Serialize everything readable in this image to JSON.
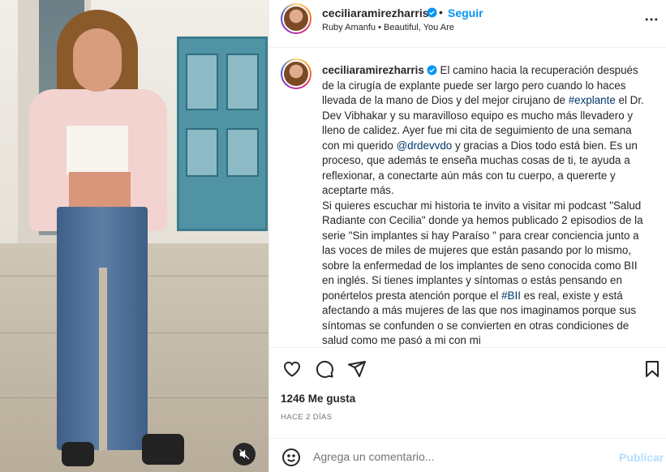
{
  "header": {
    "username": "ceciliaramirezharris",
    "separator": "•",
    "follow_label": "Seguir",
    "music": "Ruby Amanfu • Beautiful, You Are",
    "more_icon": "more-horizontal-icon"
  },
  "caption": {
    "username": "ceciliaramirezharris",
    "text_1": " El camino hacia la recuperación después de la cirugía de explante puede ser largo pero cuando lo haces llevada de la mano de Dios y del mejor cirujano de ",
    "hashtag_1": "#explante",
    "text_2": " el Dr. Dev Vibhakar y su maravilloso equipo es mucho más llevadero y lleno de calidez. Ayer fue mi cita de seguimiento de una semana con mi querido ",
    "mention_1": "@drdevvdo",
    "text_3": " y gracias a Dios todo está bien. Es un proceso, que además te enseña muchas cosas de ti, te ayuda a reflexionar, a conectarte aún más con tu cuerpo, a quererte y aceptarte más.",
    "text_4": "Si quieres escuchar mi historia te invito a visitar mi podcast \"Salud Radiante con Cecilia\" donde ya hemos publicado 2 episodios de la serie \"Sin implantes si hay Paraíso \" para crear conciencia junto a las voces de miles de mujeres que están pasando por lo mismo, sobre la enfermedad de los implantes de seno conocida como BII en inglés. Si tienes implantes y síntomas o estás pensando en ponértelos presta atención porque el ",
    "hashtag_2": "#BII",
    "text_5": " es real, existe y está afectando a más mujeres de las que nos imaginamos porque sus síntomas se confunden o se convierten en otras condiciones de salud como me pasó a mi con mi"
  },
  "actions": {
    "like_icon": "heart-icon",
    "comment_icon": "comment-bubble-icon",
    "share_icon": "paper-plane-icon",
    "save_icon": "bookmark-icon"
  },
  "stats": {
    "likes": "1246 Me gusta",
    "time_ago": "HACE 2 DÍAS"
  },
  "comment": {
    "placeholder": "Agrega un comentario...",
    "publish_label": "Publicar",
    "emoji_icon": "smiley-icon"
  },
  "media": {
    "mute_icon": "muted-speaker-icon"
  },
  "colors": {
    "accent": "#0095f6",
    "link": "#00376b",
    "publish_disabled": "#b2dffc",
    "muted_text": "#737373"
  }
}
